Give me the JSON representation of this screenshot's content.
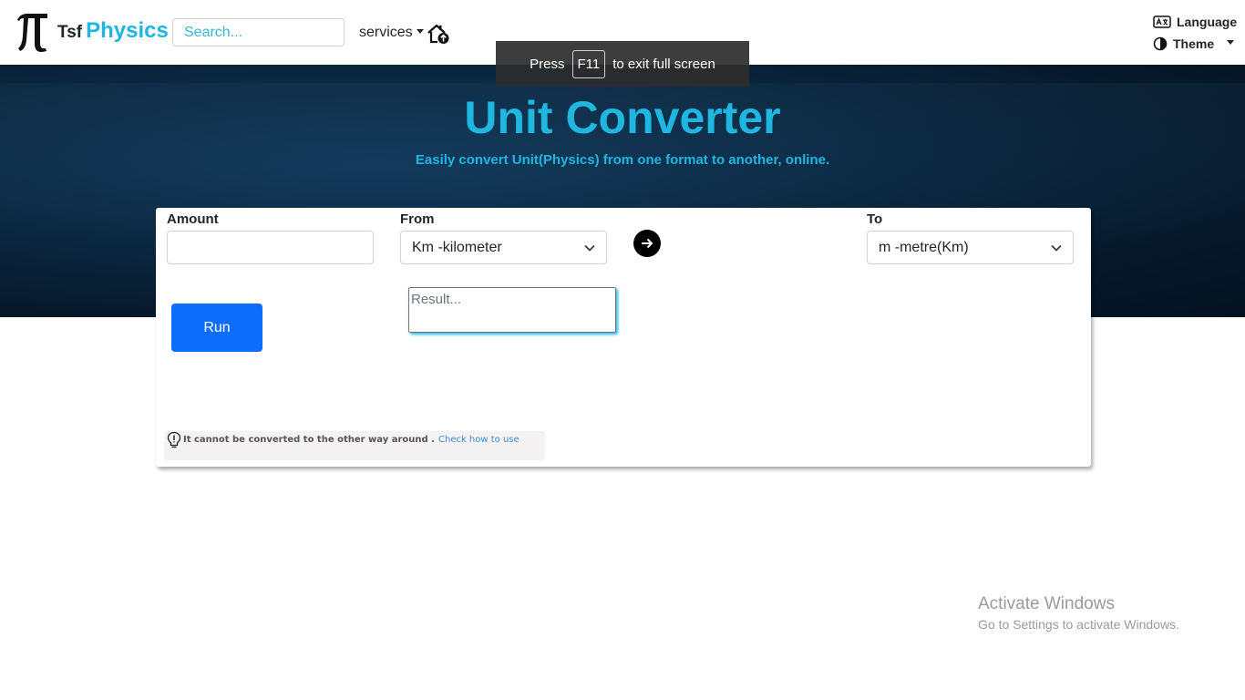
{
  "brand": {
    "prefix": "Tsf",
    "name": "Physics"
  },
  "search": {
    "placeholder": "Search..."
  },
  "nav": {
    "services_label": "services",
    "language_label": "Language",
    "theme_label": "Theme"
  },
  "fullscreen_toast": {
    "prefix": "Press",
    "key": "F11",
    "suffix": "to exit full screen"
  },
  "hero": {
    "title": "Unit Converter",
    "subtitle": "Easily convert Unit(Physics) from one format to another, online."
  },
  "converter": {
    "amount_label": "Amount",
    "amount_value": "",
    "from_label": "From",
    "from_value": "Km -kilometer",
    "to_label": "To",
    "to_value": "m -metre(Km)",
    "run_label": "Run",
    "result_placeholder": "Result..."
  },
  "tip": {
    "text": "It cannot be converted to the other way around .",
    "link": "Check how to use"
  },
  "watermark": {
    "title": "Activate Windows",
    "subtitle": "Go to Settings to activate Windows."
  },
  "colors": {
    "accent": "#1fb6e0",
    "primary_button": "#0d6efd",
    "hero_bg": "#0b2a45"
  }
}
